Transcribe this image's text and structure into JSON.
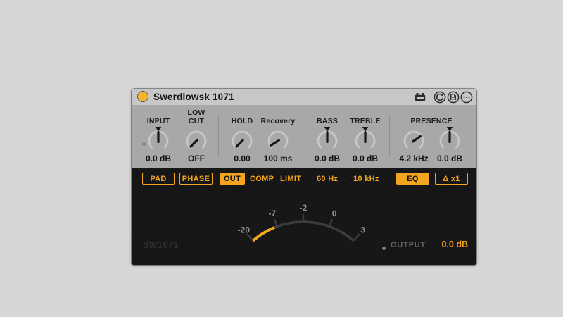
{
  "colors": {
    "accent": "#f3a51f",
    "power_fill": "#f6b42c",
    "meter_arc": "#3d3d3d",
    "meter_label": "#8f8f8f"
  },
  "window": {
    "title": "Swerdlowsk 1071",
    "power_on": true,
    "icons": [
      "hardware-icon",
      "hot-swap-icon",
      "save-preset-icon",
      "more-options-icon"
    ]
  },
  "presence_label": "PRESENCE",
  "knobs": [
    {
      "id": "input",
      "label": "INPUT",
      "value": "0.0 dB",
      "angle_deg": 0,
      "default_marker": true
    },
    {
      "id": "low-cut",
      "label": "LOW\nCUT",
      "value": "OFF",
      "angle_deg": -135,
      "default_marker": false
    },
    {
      "id": "hold",
      "label": "HOLD",
      "value": "0.00",
      "angle_deg": -135,
      "default_marker": false
    },
    {
      "id": "recovery",
      "label": "Recovery",
      "value": "100 ms",
      "angle_deg": -122,
      "default_marker": false
    },
    {
      "id": "bass",
      "label": "BASS",
      "value": "0.0 dB",
      "angle_deg": 0,
      "default_marker": true
    },
    {
      "id": "treble",
      "label": "TREBLE",
      "value": "0.0 dB",
      "angle_deg": 0,
      "default_marker": true
    },
    {
      "id": "presence-freq",
      "label": "",
      "value": "4.2 kHz",
      "angle_deg": 55,
      "default_marker": false
    },
    {
      "id": "presence-gain",
      "label": "",
      "value": "0.0 dB",
      "angle_deg": 0,
      "default_marker": true
    }
  ],
  "buttons": [
    {
      "label": "PAD",
      "state": "outline"
    },
    {
      "label": "PHASE",
      "state": "outline"
    },
    {
      "label": "OUT",
      "state": "filled"
    },
    {
      "label": "COMP",
      "state": "text"
    },
    {
      "label": "LIMIT",
      "state": "text"
    },
    {
      "label": "60 Hz",
      "state": "text"
    },
    {
      "label": "10 kHz",
      "state": "text"
    },
    {
      "label": "EQ",
      "state": "filled"
    },
    {
      "label": "Δ x1",
      "state": "outline"
    }
  ],
  "meter": {
    "radius": 109,
    "arc_start_deg": -41,
    "arc_end_deg": 41,
    "level_start_deg": -41,
    "level_end_deg": -22,
    "ticks": [
      {
        "label": "-20",
        "angle_deg": -41
      },
      {
        "label": "-7",
        "angle_deg": -20
      },
      {
        "label": "-2",
        "angle_deg": 0
      },
      {
        "label": "0",
        "angle_deg": 20
      },
      {
        "label": "3",
        "angle_deg": 41
      }
    ]
  },
  "footer": {
    "brand": "SW1071",
    "output_label": "OUTPUT",
    "output_value": "0.0 dB"
  }
}
